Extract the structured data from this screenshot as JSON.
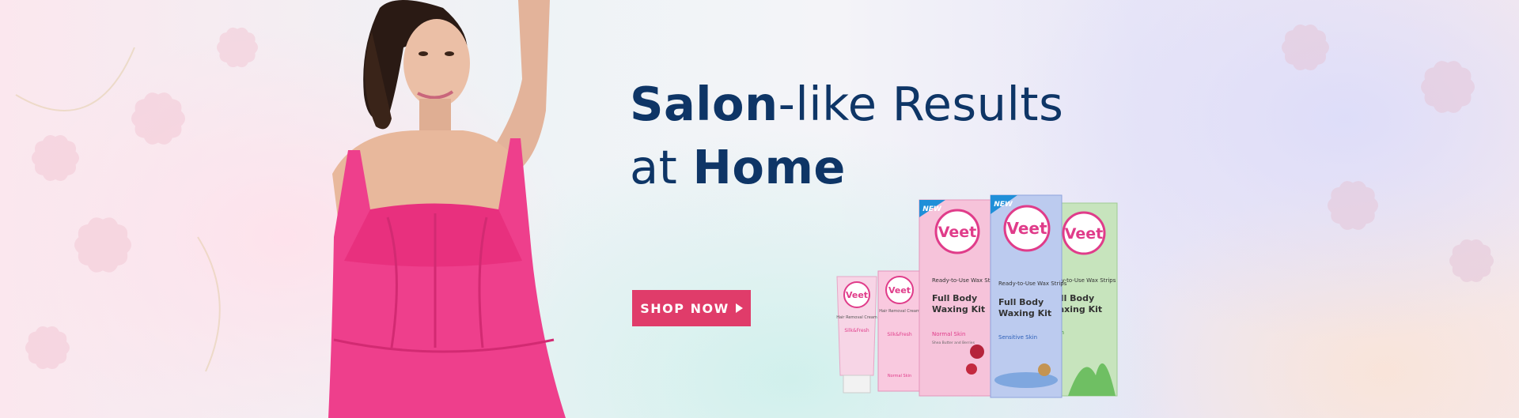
{
  "hero": {
    "headline_part1_bold": "Salon",
    "headline_part1_light": "-like Results",
    "headline_part2_light": "at ",
    "headline_part2_bold": "Home"
  },
  "cta": {
    "label": "SHOP NOW",
    "icon": "play-icon"
  },
  "products": {
    "brand": "Veet",
    "badge": "NEW",
    "tube": {
      "name": "Hair Removal Cream",
      "variant": "Silk&Fresh"
    },
    "cream_box": {
      "name": "Hair Removal Cream",
      "variant": "Silk&Fresh",
      "skin": "Normal Skin"
    },
    "kit_normal": {
      "subtitle": "Ready-to-Use Wax Strips",
      "title_line1": "Full Body",
      "title_line2": "Waxing Kit",
      "skin": "Normal Skin",
      "detail": "Shea Butter and Berries"
    },
    "kit_sensitive": {
      "subtitle": "Ready-to-Use Wax Strips",
      "title_line1": "Full Body",
      "title_line2": "Waxing Kit",
      "skin": "Sensitive Skin"
    },
    "kit_dry": {
      "subtitle": "Ready-to-Use Wax Strips",
      "title_line1": "Full Body",
      "title_line2": "Waxing Kit",
      "skin": "Skin"
    }
  },
  "colors": {
    "headline": "#0e3566",
    "cta": "#e03c6a",
    "dress": "#ee3f8c",
    "kit_pink": "#f4b8d2",
    "kit_blue": "#b9c9ee",
    "kit_green": "#b8ddb0"
  }
}
